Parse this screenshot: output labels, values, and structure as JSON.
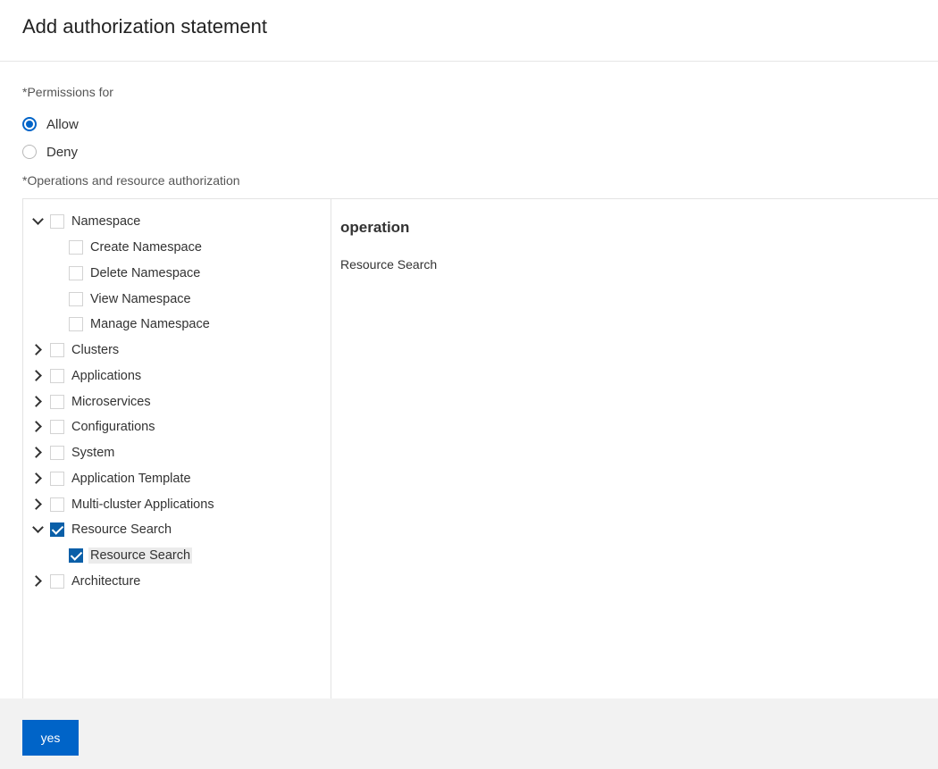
{
  "dialog": {
    "title": "Add authorization statement"
  },
  "permissions": {
    "label": "*Permissions for",
    "options": [
      {
        "label": "Allow",
        "selected": true
      },
      {
        "label": "Deny",
        "selected": false
      }
    ]
  },
  "operations": {
    "label": "*Operations and resource authorization",
    "tree": [
      {
        "label": "Namespace",
        "expanded": true,
        "checked": false
      },
      {
        "label": "Create Namespace",
        "checked": false
      },
      {
        "label": "Delete Namespace",
        "checked": false
      },
      {
        "label": "View Namespace",
        "checked": false
      },
      {
        "label": "Manage Namespace",
        "checked": false
      },
      {
        "label": "Clusters",
        "expanded": false,
        "checked": false
      },
      {
        "label": "Applications",
        "expanded": false,
        "checked": false
      },
      {
        "label": "Microservices",
        "expanded": false,
        "checked": false
      },
      {
        "label": "Configurations",
        "expanded": false,
        "checked": false
      },
      {
        "label": "System",
        "expanded": false,
        "checked": false
      },
      {
        "label": "Application Template",
        "expanded": false,
        "checked": false
      },
      {
        "label": "Multi-cluster Applications",
        "expanded": false,
        "checked": false
      },
      {
        "label": "Resource Search",
        "expanded": true,
        "checked": true
      },
      {
        "label": "Resource Search",
        "checked": true
      },
      {
        "label": "Architecture",
        "expanded": false,
        "checked": false
      }
    ]
  },
  "detail": {
    "title": "operation",
    "items": [
      "Resource Search"
    ]
  },
  "footer": {
    "yes_label": "yes"
  },
  "colors": {
    "accent": "#0064c8",
    "checkbox_checked": "#0a5fa8",
    "footer_bg": "#f2f2f2"
  }
}
